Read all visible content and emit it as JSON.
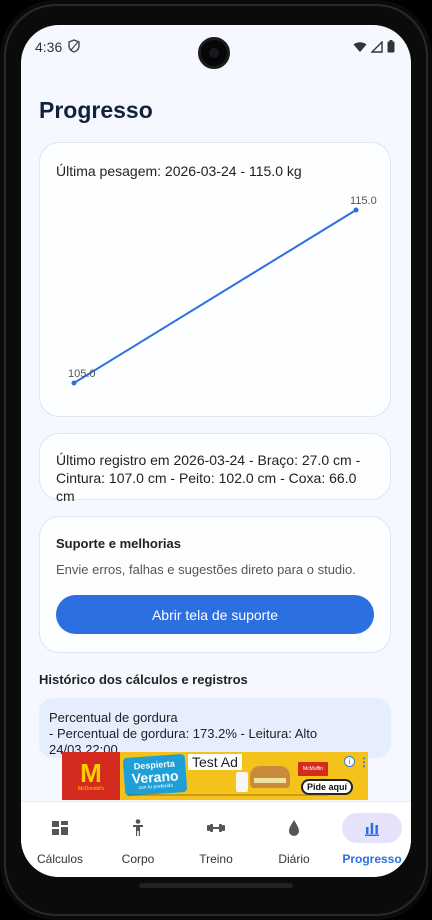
{
  "status_bar": {
    "time": "4:36"
  },
  "page": {
    "title": "Progresso"
  },
  "weight_card": {
    "text": "Última pesagem: 2026-03-24 - 115.0 kg",
    "chart_data": {
      "type": "line",
      "x": [
        1,
        2
      ],
      "values": [
        105.0,
        115.0
      ],
      "point_labels": [
        "105.0",
        "115.0"
      ],
      "color": "#2c6fe0",
      "grid": false,
      "ylim": [
        105.0,
        115.0
      ]
    }
  },
  "measurements_card": {
    "text": "Último registro em 2026-03-24 - Braço: 27.0 cm - Cintura: 107.0 cm - Peito: 102.0 cm - Coxa: 66.0 cm"
  },
  "support_card": {
    "title": "Suporte e melhorias",
    "description": "Envie erros, falhas e sugestões direto para o studio.",
    "button_label": "Abrir tela de suporte"
  },
  "history": {
    "title": "Histórico dos cálculos e registros",
    "items": [
      {
        "title": "Percentual de gordura",
        "detail": "- Percentual de gordura: 173.2% - Leitura: Alto",
        "date": "24/03 22:00"
      }
    ]
  },
  "ad": {
    "label": "Test Ad",
    "sign_line1": "Despierta",
    "sign_line2": "Verano",
    "sign_line3": "con tu preferido",
    "product": "McMuffin",
    "cta": "Pide aquí",
    "brand": "McDonald's",
    "info_glyph": "i",
    "more_glyph": "⋮"
  },
  "nav": {
    "items": [
      {
        "label": "Cálculos",
        "icon": "dashboard-icon",
        "active": false
      },
      {
        "label": "Corpo",
        "icon": "person-icon",
        "active": false
      },
      {
        "label": "Treino",
        "icon": "dumbbell-icon",
        "active": false
      },
      {
        "label": "Diário",
        "icon": "water-drop-icon",
        "active": false
      },
      {
        "label": "Progresso",
        "icon": "bar-chart-icon",
        "active": true
      }
    ]
  },
  "colors": {
    "accent": "#2c6fe0",
    "background": "#f5f8ff",
    "active_pill": "#e4e3fb"
  }
}
